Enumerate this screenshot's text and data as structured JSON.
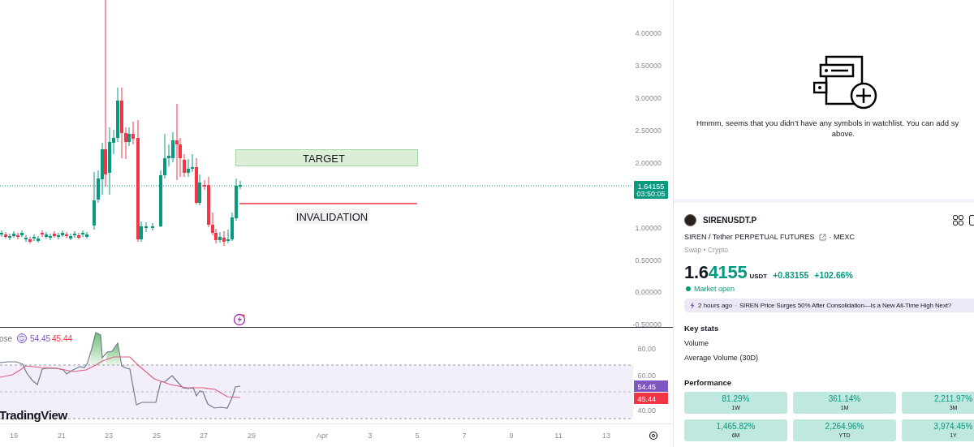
{
  "chart": {
    "price_axis": [
      "4.00000",
      "3.50000",
      "3.00000",
      "2.50000",
      "2.00000",
      "1.00000",
      "0.50000",
      "0.00000",
      "-0.50000"
    ],
    "last_price": {
      "price": "1.64155",
      "countdown": "03:50:05"
    },
    "drawings": [
      {
        "kind": "zone",
        "label": "TARGET"
      },
      {
        "kind": "line",
        "label": "INVALIDATION"
      }
    ]
  },
  "rsi": {
    "legend": {
      "label": "ose",
      "rsi": "54.45",
      "ma": "45.44"
    },
    "axis": [
      "80.00",
      "60.00",
      "40.00"
    ],
    "tags": {
      "rsi": "54.45",
      "ma": "45.44"
    },
    "logo": "TradingView"
  },
  "time_axis": [
    "19",
    "21",
    "23",
    "25",
    "27",
    "29",
    "Apr",
    "3",
    "5",
    "7",
    "9",
    "11",
    "13"
  ],
  "watchlist": {
    "empty_message": [
      "Hmmm, seems that you didn’t have any symbols in watchlist. You can add sy",
      "above."
    ]
  },
  "symbol": {
    "ticker": "SIRENUSDT.P",
    "description": "SIREN / Tether PERPETUAL FUTURES",
    "exchange": "· MEXC",
    "category": "Swap • Crypto",
    "price_lead": "1.6",
    "price_tail": "4155",
    "currency": "USDT",
    "change": "+0.83155",
    "change_percent": "+102.66%",
    "market_status": "Market open"
  },
  "news": {
    "time": "2 hours ago",
    "separator": "·",
    "headline": "SIREN Price Surges 50% After Consolidation—Is a New All-Time High Next?"
  },
  "key_stats": {
    "title": "Key stats",
    "rows": [
      "Volume",
      "Average Volume (30D)"
    ]
  },
  "performance": {
    "title": "Performance",
    "cards": [
      {
        "value": "81.29%",
        "period": "1W"
      },
      {
        "value": "361.14%",
        "period": "1M"
      },
      {
        "value": "2,211.97%",
        "period": "3M"
      },
      {
        "value": "1,465.82%",
        "period": "6M"
      },
      {
        "value": "2,264.96%",
        "period": "YTD"
      },
      {
        "value": "3,974.45%",
        "period": "1Y"
      }
    ]
  }
}
